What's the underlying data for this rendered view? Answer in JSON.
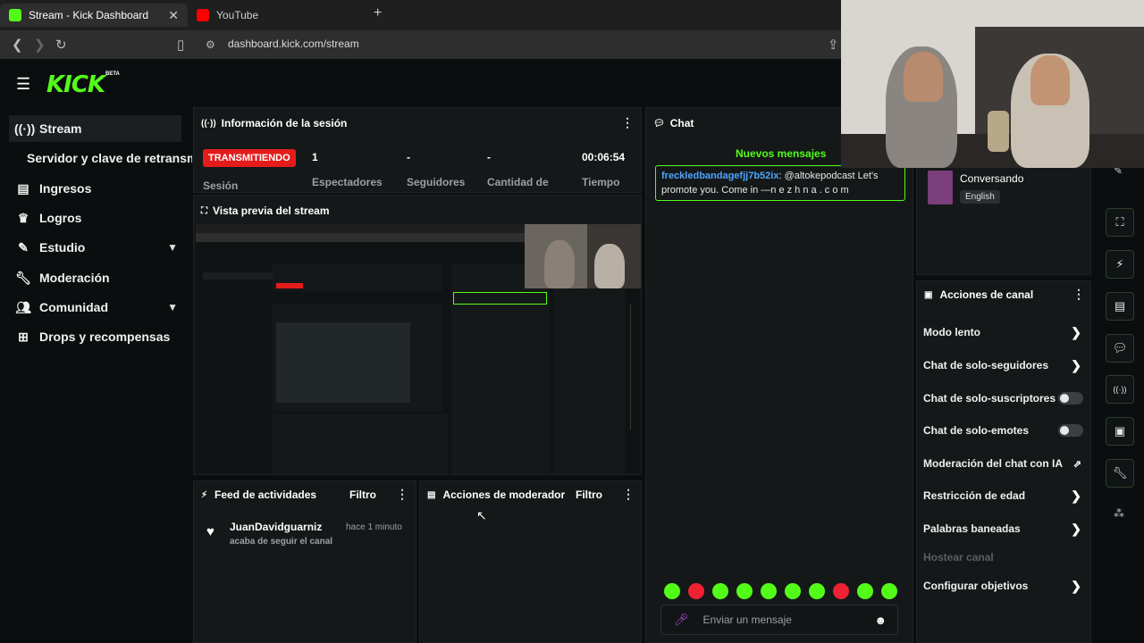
{
  "browser": {
    "tabs": [
      {
        "title": "Stream - Kick Dashboard",
        "favicon_color": "#53fc18"
      },
      {
        "title": "YouTube",
        "favicon_color": "#ff0000"
      }
    ],
    "url": "dashboard.kick.com/stream"
  },
  "brand": {
    "logo": "KICK",
    "beta": "BETA",
    "accent": "#53fc18"
  },
  "sidebar": {
    "items": [
      {
        "label": "Stream",
        "icon": "broadcast-icon"
      },
      {
        "label": "Servidor y clave de retransmisión",
        "icon": ""
      },
      {
        "label": "Ingresos",
        "icon": "money-icon"
      },
      {
        "label": "Logros",
        "icon": "trophy-icon"
      },
      {
        "label": "Estudio",
        "icon": "brush-icon"
      },
      {
        "label": "Moderación",
        "icon": "wrench-icon"
      },
      {
        "label": "Comunidad",
        "icon": "people-icon"
      },
      {
        "label": "Drops y recompensas",
        "icon": "gift-icon"
      }
    ]
  },
  "session": {
    "title": "Información de la sesión",
    "status": "TRANSMITIENDO",
    "status_label": "Sesión",
    "stats": [
      {
        "value": "1",
        "label": "Espectadores"
      },
      {
        "value": "-",
        "label": "Seguidores"
      },
      {
        "value": "-",
        "label": "Cantidad de"
      },
      {
        "value": "00:06:54",
        "label": "Tiempo"
      }
    ]
  },
  "preview": {
    "title": "Vista previa del stream"
  },
  "feed": {
    "title": "Feed de actividades",
    "filter": "Filtro",
    "items": [
      {
        "user": "JuanDavidguarniz",
        "time": "hace 1 minuto",
        "action": "acaba de seguir el canal"
      }
    ]
  },
  "mod_actions": {
    "title": "Acciones de moderador",
    "filter": "Filtro"
  },
  "chat": {
    "title": "Chat",
    "new_messages": "Nuevos mensajes",
    "messages": [
      {
        "user": "freckledbandagefjj7b52ix",
        "text": ": @altokepodcast Let's promote you. Come in —n e z h n a . c o m"
      }
    ],
    "input_placeholder": "Enviar un mensaje"
  },
  "category": {
    "name": "Conversando",
    "language": "English"
  },
  "channel_actions": {
    "title": "Acciones de canal",
    "items": [
      {
        "label": "Modo lento",
        "control": "arrow"
      },
      {
        "label": "Chat de solo-seguidores",
        "control": "arrow"
      },
      {
        "label": "Chat de solo-suscriptores",
        "control": "toggle"
      },
      {
        "label": "Chat de solo-emotes",
        "control": "toggle"
      },
      {
        "label": "Moderación del chat con IA",
        "control": "external"
      },
      {
        "label": "Restricción de edad",
        "control": "arrow"
      },
      {
        "label": "Palabras baneadas",
        "control": "arrow"
      },
      {
        "label": "Hostear canal",
        "control": "disabled"
      },
      {
        "label": "Configurar objetivos",
        "control": "arrow"
      }
    ]
  },
  "colors": {
    "live": "#e41c1c",
    "username": "#4da6ff",
    "toggle_off": "#3a3f42"
  }
}
